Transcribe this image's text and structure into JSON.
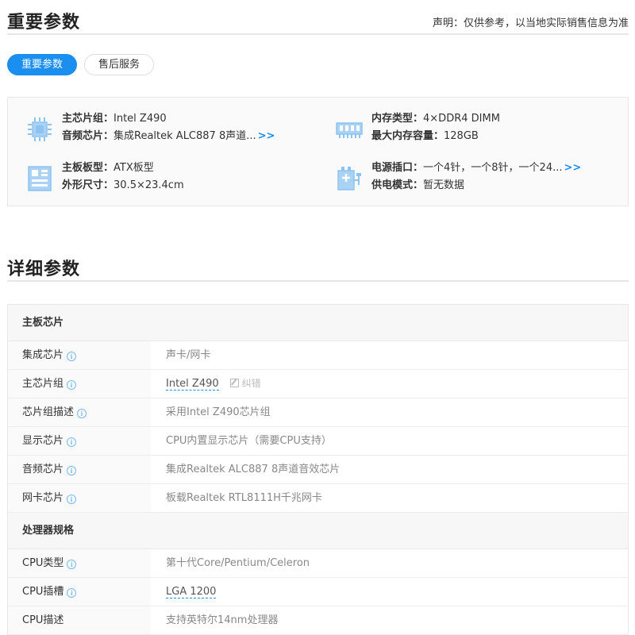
{
  "header": {
    "title": "重要参数",
    "disclaimer": "声明：仅供参考，以当地实际销售信息为准"
  },
  "tabs": [
    {
      "label": "重要参数",
      "active": true
    },
    {
      "label": "售后服务",
      "active": false
    }
  ],
  "key_params": [
    {
      "icon": "chip-icon",
      "lines": [
        {
          "label": "主芯片组：",
          "value": "Intel Z490",
          "more": ""
        },
        {
          "label": "音频芯片：",
          "value": "集成Realtek ALC887 8声道...",
          "more": ">>"
        }
      ]
    },
    {
      "icon": "memory-icon",
      "lines": [
        {
          "label": "内存类型：",
          "value": "4×DDR4 DIMM",
          "more": ""
        },
        {
          "label": "最大内存容量：",
          "value": "128GB",
          "more": ""
        }
      ]
    },
    {
      "icon": "board-icon",
      "lines": [
        {
          "label": "主板板型：",
          "value": "ATX板型",
          "more": ""
        },
        {
          "label": "外形尺寸：",
          "value": "30.5×23.4cm",
          "more": ""
        }
      ]
    },
    {
      "icon": "power-icon",
      "lines": [
        {
          "label": "电源插口：",
          "value": "一个4针，一个8针，一个24...",
          "more": ">>"
        },
        {
          "label": "供电模式：",
          "value": "暂无数据",
          "more": ""
        }
      ]
    }
  ],
  "detail": {
    "title": "详细参数",
    "correct_label": "纠错",
    "info_glyph": "i",
    "groups": [
      {
        "name": "主板芯片",
        "rows": [
          {
            "name": "集成芯片",
            "info": true,
            "value": "声卡/网卡",
            "link": false
          },
          {
            "name": "主芯片组",
            "info": true,
            "value": "Intel Z490",
            "link": true,
            "correct": true
          },
          {
            "name": "芯片组描述",
            "info": true,
            "value": "采用Intel Z490芯片组",
            "link": false
          },
          {
            "name": "显示芯片",
            "info": true,
            "value": "CPU内置显示芯片（需要CPU支持）",
            "link": false
          },
          {
            "name": "音频芯片",
            "info": true,
            "value": "集成Realtek ALC887 8声道音效芯片",
            "link": false
          },
          {
            "name": "网卡芯片",
            "info": true,
            "value": "板载Realtek RTL8111H千兆网卡",
            "link": false
          }
        ]
      },
      {
        "name": "处理器规格",
        "rows": [
          {
            "name": "CPU类型",
            "info": true,
            "value": "第十代Core/Pentium/Celeron",
            "link": false
          },
          {
            "name": "CPU插槽",
            "info": true,
            "value": "LGA 1200",
            "link": true
          },
          {
            "name": "CPU描述",
            "info": false,
            "value": "支持英特尔14nm处理器",
            "link": false
          }
        ]
      }
    ]
  },
  "colors": {
    "accent": "#1a8ff0",
    "icon": "#8cc3f0"
  }
}
